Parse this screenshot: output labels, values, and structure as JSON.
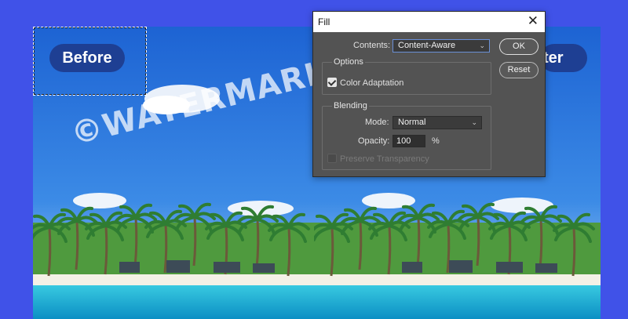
{
  "comparison": {
    "before_label": "Before",
    "after_label": "ter",
    "watermark_text": "©WATERMARK"
  },
  "dialog": {
    "title": "Fill",
    "close_glyph": "✕",
    "contents_label": "Contents:",
    "contents_value": "Content-Aware",
    "options_group": "Options",
    "color_adaptation_label": "Color Adaptation",
    "color_adaptation_checked": true,
    "blending_group": "Blending",
    "mode_label": "Mode:",
    "mode_value": "Normal",
    "opacity_label": "Opacity:",
    "opacity_value": "100",
    "opacity_unit": "%",
    "preserve_transparency_label": "Preserve Transparency",
    "preserve_transparency_checked": false,
    "ok_label": "OK",
    "reset_label": "Reset",
    "chevron_glyph": "⌄"
  },
  "colors": {
    "background": "#4052e8",
    "pill": "#1e3f93",
    "dialog_body": "#535353",
    "sky": "#1f6fd8",
    "sea": "#1ab6d6"
  }
}
